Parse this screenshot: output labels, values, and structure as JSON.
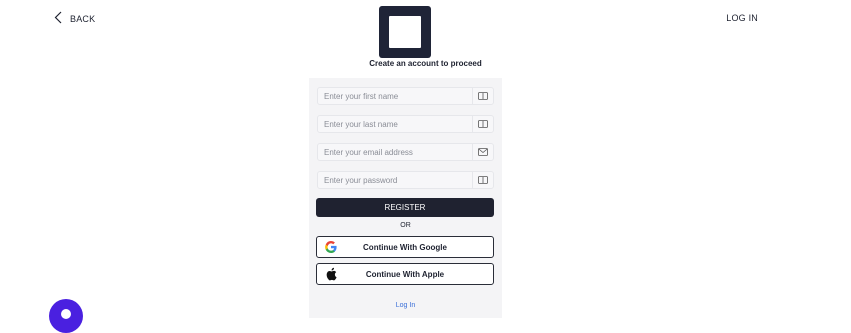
{
  "nav": {
    "back_label": "BACK",
    "login_label": "LOG IN"
  },
  "heading": "Create an account to proceed",
  "form": {
    "fields": [
      {
        "placeholder": "Enter your first name",
        "icon": "id-card-icon"
      },
      {
        "placeholder": "Enter your last name",
        "icon": "id-card-icon"
      },
      {
        "placeholder": "Enter your email address",
        "icon": "mail-icon"
      },
      {
        "placeholder": "Enter your password",
        "icon": "key-icon"
      }
    ],
    "register_label": "REGISTER",
    "or_label": "OR",
    "google_label": "Continue With Google",
    "apple_label": "Continue With Apple",
    "login_link": "Log In"
  },
  "colors": {
    "primary": "#1f2230",
    "logo": "#1f2437",
    "link": "#3a6fd8",
    "help_bubble": "#4a20e0"
  }
}
